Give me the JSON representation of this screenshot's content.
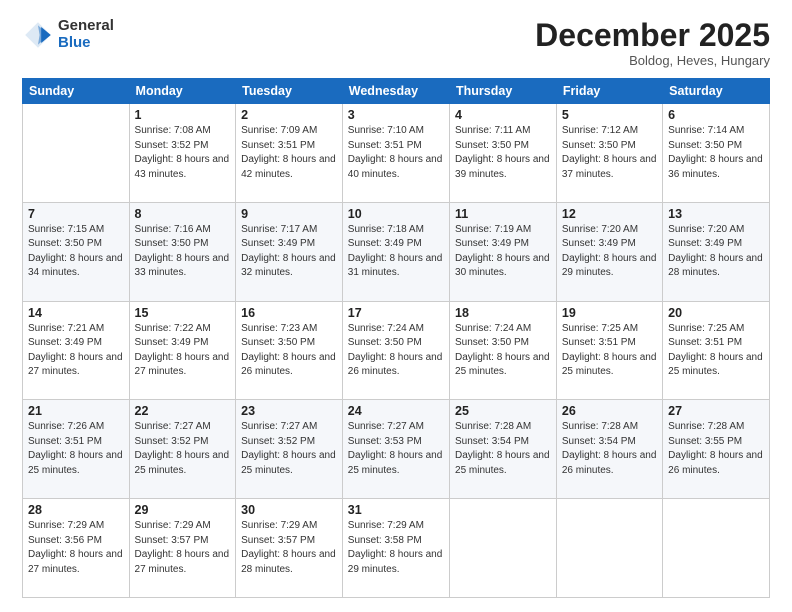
{
  "logo": {
    "general": "General",
    "blue": "Blue"
  },
  "header": {
    "title": "December 2025",
    "subtitle": "Boldog, Heves, Hungary"
  },
  "days_of_week": [
    "Sunday",
    "Monday",
    "Tuesday",
    "Wednesday",
    "Thursday",
    "Friday",
    "Saturday"
  ],
  "weeks": [
    [
      {
        "day": "",
        "sunrise": "",
        "sunset": "",
        "daylight": ""
      },
      {
        "day": "1",
        "sunrise": "Sunrise: 7:08 AM",
        "sunset": "Sunset: 3:52 PM",
        "daylight": "Daylight: 8 hours and 43 minutes."
      },
      {
        "day": "2",
        "sunrise": "Sunrise: 7:09 AM",
        "sunset": "Sunset: 3:51 PM",
        "daylight": "Daylight: 8 hours and 42 minutes."
      },
      {
        "day": "3",
        "sunrise": "Sunrise: 7:10 AM",
        "sunset": "Sunset: 3:51 PM",
        "daylight": "Daylight: 8 hours and 40 minutes."
      },
      {
        "day": "4",
        "sunrise": "Sunrise: 7:11 AM",
        "sunset": "Sunset: 3:50 PM",
        "daylight": "Daylight: 8 hours and 39 minutes."
      },
      {
        "day": "5",
        "sunrise": "Sunrise: 7:12 AM",
        "sunset": "Sunset: 3:50 PM",
        "daylight": "Daylight: 8 hours and 37 minutes."
      },
      {
        "day": "6",
        "sunrise": "Sunrise: 7:14 AM",
        "sunset": "Sunset: 3:50 PM",
        "daylight": "Daylight: 8 hours and 36 minutes."
      }
    ],
    [
      {
        "day": "7",
        "sunrise": "Sunrise: 7:15 AM",
        "sunset": "Sunset: 3:50 PM",
        "daylight": "Daylight: 8 hours and 34 minutes."
      },
      {
        "day": "8",
        "sunrise": "Sunrise: 7:16 AM",
        "sunset": "Sunset: 3:50 PM",
        "daylight": "Daylight: 8 hours and 33 minutes."
      },
      {
        "day": "9",
        "sunrise": "Sunrise: 7:17 AM",
        "sunset": "Sunset: 3:49 PM",
        "daylight": "Daylight: 8 hours and 32 minutes."
      },
      {
        "day": "10",
        "sunrise": "Sunrise: 7:18 AM",
        "sunset": "Sunset: 3:49 PM",
        "daylight": "Daylight: 8 hours and 31 minutes."
      },
      {
        "day": "11",
        "sunrise": "Sunrise: 7:19 AM",
        "sunset": "Sunset: 3:49 PM",
        "daylight": "Daylight: 8 hours and 30 minutes."
      },
      {
        "day": "12",
        "sunrise": "Sunrise: 7:20 AM",
        "sunset": "Sunset: 3:49 PM",
        "daylight": "Daylight: 8 hours and 29 minutes."
      },
      {
        "day": "13",
        "sunrise": "Sunrise: 7:20 AM",
        "sunset": "Sunset: 3:49 PM",
        "daylight": "Daylight: 8 hours and 28 minutes."
      }
    ],
    [
      {
        "day": "14",
        "sunrise": "Sunrise: 7:21 AM",
        "sunset": "Sunset: 3:49 PM",
        "daylight": "Daylight: 8 hours and 27 minutes."
      },
      {
        "day": "15",
        "sunrise": "Sunrise: 7:22 AM",
        "sunset": "Sunset: 3:49 PM",
        "daylight": "Daylight: 8 hours and 27 minutes."
      },
      {
        "day": "16",
        "sunrise": "Sunrise: 7:23 AM",
        "sunset": "Sunset: 3:50 PM",
        "daylight": "Daylight: 8 hours and 26 minutes."
      },
      {
        "day": "17",
        "sunrise": "Sunrise: 7:24 AM",
        "sunset": "Sunset: 3:50 PM",
        "daylight": "Daylight: 8 hours and 26 minutes."
      },
      {
        "day": "18",
        "sunrise": "Sunrise: 7:24 AM",
        "sunset": "Sunset: 3:50 PM",
        "daylight": "Daylight: 8 hours and 25 minutes."
      },
      {
        "day": "19",
        "sunrise": "Sunrise: 7:25 AM",
        "sunset": "Sunset: 3:51 PM",
        "daylight": "Daylight: 8 hours and 25 minutes."
      },
      {
        "day": "20",
        "sunrise": "Sunrise: 7:25 AM",
        "sunset": "Sunset: 3:51 PM",
        "daylight": "Daylight: 8 hours and 25 minutes."
      }
    ],
    [
      {
        "day": "21",
        "sunrise": "Sunrise: 7:26 AM",
        "sunset": "Sunset: 3:51 PM",
        "daylight": "Daylight: 8 hours and 25 minutes."
      },
      {
        "day": "22",
        "sunrise": "Sunrise: 7:27 AM",
        "sunset": "Sunset: 3:52 PM",
        "daylight": "Daylight: 8 hours and 25 minutes."
      },
      {
        "day": "23",
        "sunrise": "Sunrise: 7:27 AM",
        "sunset": "Sunset: 3:52 PM",
        "daylight": "Daylight: 8 hours and 25 minutes."
      },
      {
        "day": "24",
        "sunrise": "Sunrise: 7:27 AM",
        "sunset": "Sunset: 3:53 PM",
        "daylight": "Daylight: 8 hours and 25 minutes."
      },
      {
        "day": "25",
        "sunrise": "Sunrise: 7:28 AM",
        "sunset": "Sunset: 3:54 PM",
        "daylight": "Daylight: 8 hours and 25 minutes."
      },
      {
        "day": "26",
        "sunrise": "Sunrise: 7:28 AM",
        "sunset": "Sunset: 3:54 PM",
        "daylight": "Daylight: 8 hours and 26 minutes."
      },
      {
        "day": "27",
        "sunrise": "Sunrise: 7:28 AM",
        "sunset": "Sunset: 3:55 PM",
        "daylight": "Daylight: 8 hours and 26 minutes."
      }
    ],
    [
      {
        "day": "28",
        "sunrise": "Sunrise: 7:29 AM",
        "sunset": "Sunset: 3:56 PM",
        "daylight": "Daylight: 8 hours and 27 minutes."
      },
      {
        "day": "29",
        "sunrise": "Sunrise: 7:29 AM",
        "sunset": "Sunset: 3:57 PM",
        "daylight": "Daylight: 8 hours and 27 minutes."
      },
      {
        "day": "30",
        "sunrise": "Sunrise: 7:29 AM",
        "sunset": "Sunset: 3:57 PM",
        "daylight": "Daylight: 8 hours and 28 minutes."
      },
      {
        "day": "31",
        "sunrise": "Sunrise: 7:29 AM",
        "sunset": "Sunset: 3:58 PM",
        "daylight": "Daylight: 8 hours and 29 minutes."
      },
      {
        "day": "",
        "sunrise": "",
        "sunset": "",
        "daylight": ""
      },
      {
        "day": "",
        "sunrise": "",
        "sunset": "",
        "daylight": ""
      },
      {
        "day": "",
        "sunrise": "",
        "sunset": "",
        "daylight": ""
      }
    ]
  ]
}
